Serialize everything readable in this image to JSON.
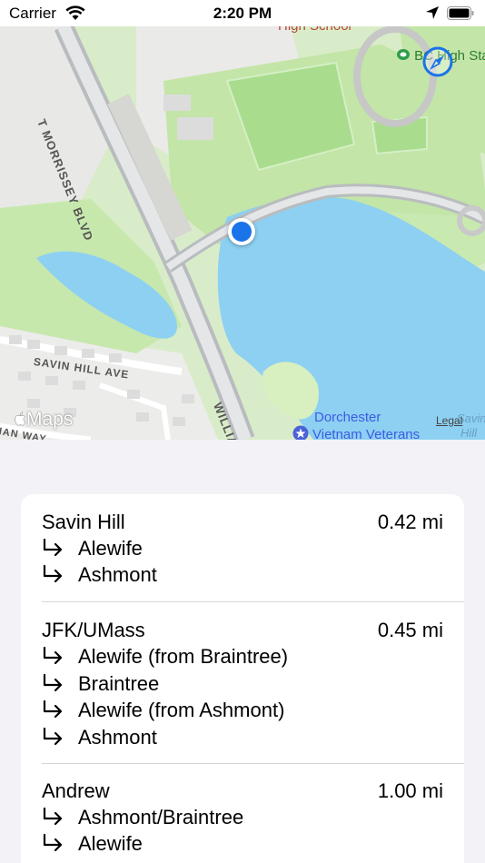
{
  "status_bar": {
    "carrier": "Carrier",
    "time": "2:20 PM"
  },
  "map": {
    "street_labels": {
      "morrissey": "T MORRISSEY BLVD",
      "william": "WILLIAM T",
      "savin_hill_ave": "SAVIN HILL AVE",
      "way": "IAN WAY"
    },
    "poi_labels": {
      "school": "High School",
      "bc_high": "BC High Stad",
      "dorchester_line1": "Dorchester",
      "dorchester_line2": "Vietnam Veterans",
      "savin_line1": "Savin",
      "savin_line2": "Hill"
    },
    "attribution": "Maps",
    "legal": "Legal"
  },
  "stations": [
    {
      "name": "Savin Hill",
      "distance": "0.42 mi",
      "destinations": [
        "Alewife",
        "Ashmont"
      ]
    },
    {
      "name": "JFK/UMass",
      "distance": "0.45 mi",
      "destinations": [
        "Alewife (from Braintree)",
        "Braintree",
        "Alewife (from Ashmont)",
        "Ashmont"
      ]
    },
    {
      "name": "Andrew",
      "distance": "1.00 mi",
      "destinations": [
        "Ashmont/Braintree",
        "Alewife"
      ]
    }
  ],
  "colors": {
    "accent": "#1a73e8",
    "park": "#c3e5a8",
    "water": "#8dd0f2"
  }
}
